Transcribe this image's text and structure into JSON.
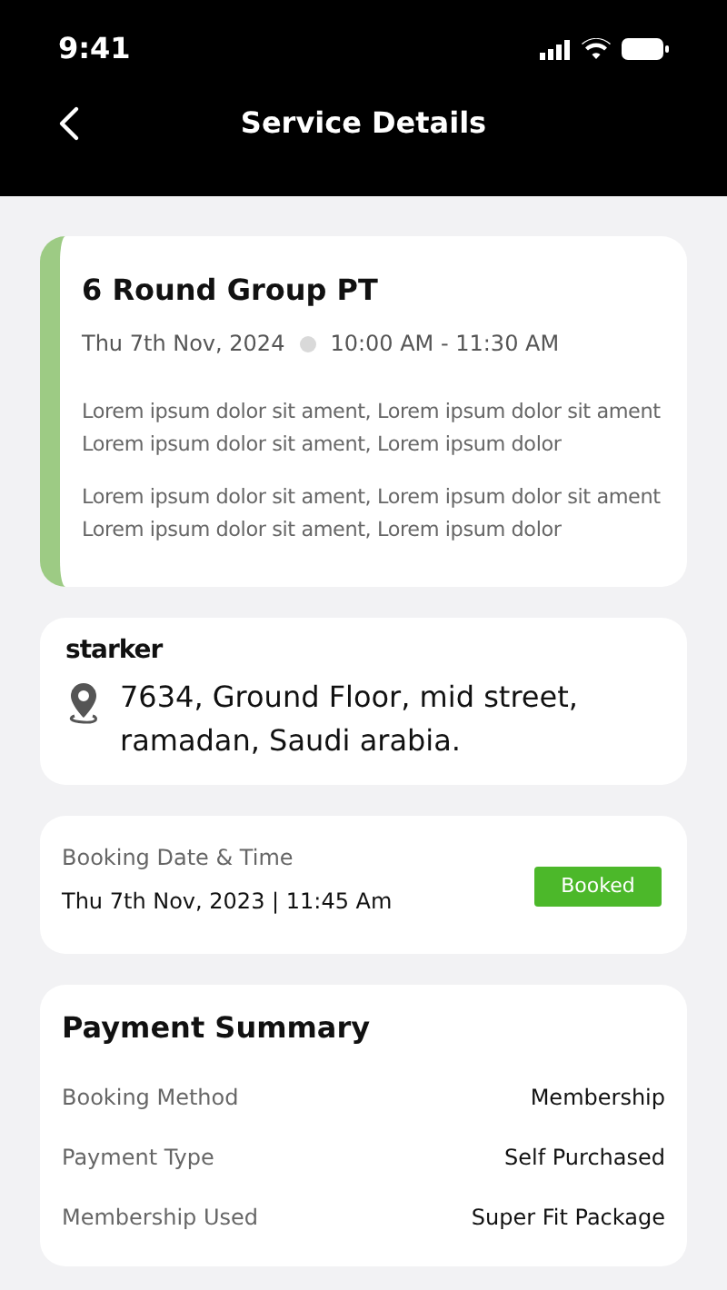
{
  "status_bar": {
    "time": "9:41"
  },
  "header": {
    "title": "Service Details"
  },
  "session": {
    "title": "6 Round Group PT",
    "date": "Thu 7th Nov, 2024",
    "time": "10:00 AM - 11:30 AM",
    "paragraphs": [
      "Lorem ipsum dolor sit ament, Lorem ipsum dolor sit ament Lorem ipsum dolor sit ament, Lorem ipsum dolor",
      "Lorem ipsum dolor sit ament, Lorem ipsum dolor sit ament Lorem ipsum dolor sit ament, Lorem ipsum dolor"
    ]
  },
  "venue": {
    "logo": "starker",
    "address": "7634, Ground Floor, mid street, ramadan, Saudi arabia."
  },
  "booking": {
    "label": "Booking Date & Time",
    "value": "Thu 7th Nov, 2023 | 11:45 Am",
    "status": "Booked"
  },
  "payment_summary": {
    "title": "Payment Summary",
    "rows": [
      {
        "label": "Booking Method",
        "value": "Membership"
      },
      {
        "label": "Payment Type",
        "value": "Self Purchased"
      },
      {
        "label": "Membership Used",
        "value": "Super Fit Package"
      }
    ]
  }
}
